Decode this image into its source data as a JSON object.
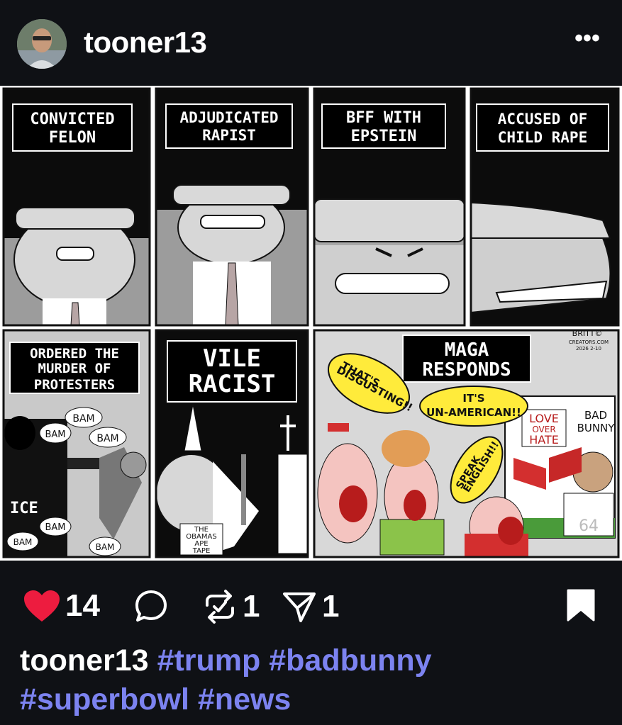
{
  "post": {
    "username": "tooner13",
    "more_label": "•••"
  },
  "comic": {
    "panels": {
      "p1": [
        "CONVICTED",
        "FELON"
      ],
      "p2": [
        "ADJUDICATED",
        "RAPIST"
      ],
      "p3": [
        "BFF WITH",
        "EPSTEIN"
      ],
      "p4": [
        "ACCUSED OF",
        "CHILD RAPE"
      ],
      "p5": [
        "ORDERED THE",
        "MURDER OF",
        "PROTESTERS"
      ],
      "p6": [
        "VILE",
        "RACIST"
      ],
      "p7": [
        "MAGA",
        "RESPONDS"
      ]
    },
    "bam": "BAM",
    "ice": "ICE",
    "sign": [
      "THE",
      "OBAMAS",
      "APE",
      "TAPE"
    ],
    "bubbles": {
      "disgusting": [
        "THAT'S",
        "DISGUSTING!!"
      ],
      "unamerican": [
        "IT'S",
        "UN-AMERICAN!!"
      ],
      "english": [
        "SPEAK",
        "ENGLISH!!"
      ]
    },
    "tv": {
      "love": [
        "LOVE",
        "OVER",
        "HATE"
      ],
      "bad_bunny": [
        "BAD",
        "BUNNY"
      ],
      "jersey": "64"
    },
    "signature": [
      "BRITT©",
      "CREATORS.COM",
      "2026 2-10"
    ]
  },
  "actions": {
    "likes": "14",
    "reposts": "1",
    "shares": "1"
  },
  "caption": {
    "user": "tooner13",
    "hashtags": [
      "#trump",
      "#badbunny",
      "#superbowl",
      "#news"
    ]
  },
  "colors": {
    "background": "#0f1115",
    "heart": "#ed1c3f",
    "hashtag": "#7c83f0"
  }
}
